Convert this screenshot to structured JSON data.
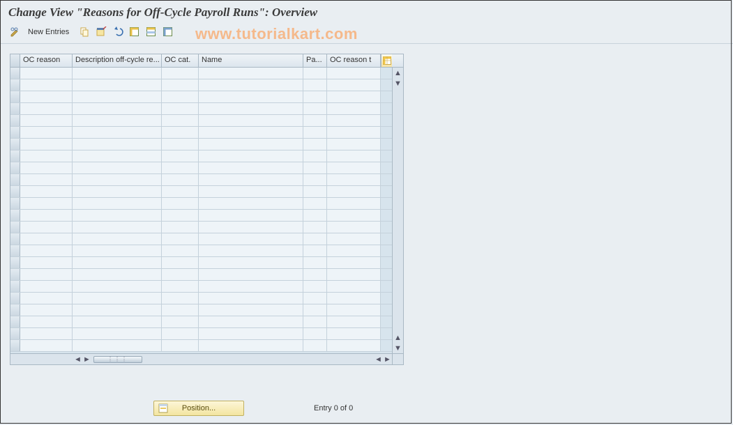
{
  "title": "Change View \"Reasons for Off-Cycle Payroll Runs\": Overview",
  "toolbar": {
    "new_entries": "New Entries"
  },
  "watermark": "www.tutorialkart.com",
  "grid": {
    "columns": [
      "OC reason",
      "Description off-cycle re...",
      "OC cat.",
      "Name",
      "Pa...",
      "OC reason t"
    ],
    "row_count": 24
  },
  "footer": {
    "position_label": "Position...",
    "entry_text": "Entry 0 of 0"
  },
  "icons": {
    "pencil": "pencil-icon",
    "copy": "copy-icon",
    "delete": "delete-icon",
    "undo": "undo-icon",
    "select_all": "select-all-icon",
    "select_block": "select-block-icon",
    "deselect": "deselect-icon",
    "table_settings": "table-settings-icon"
  }
}
